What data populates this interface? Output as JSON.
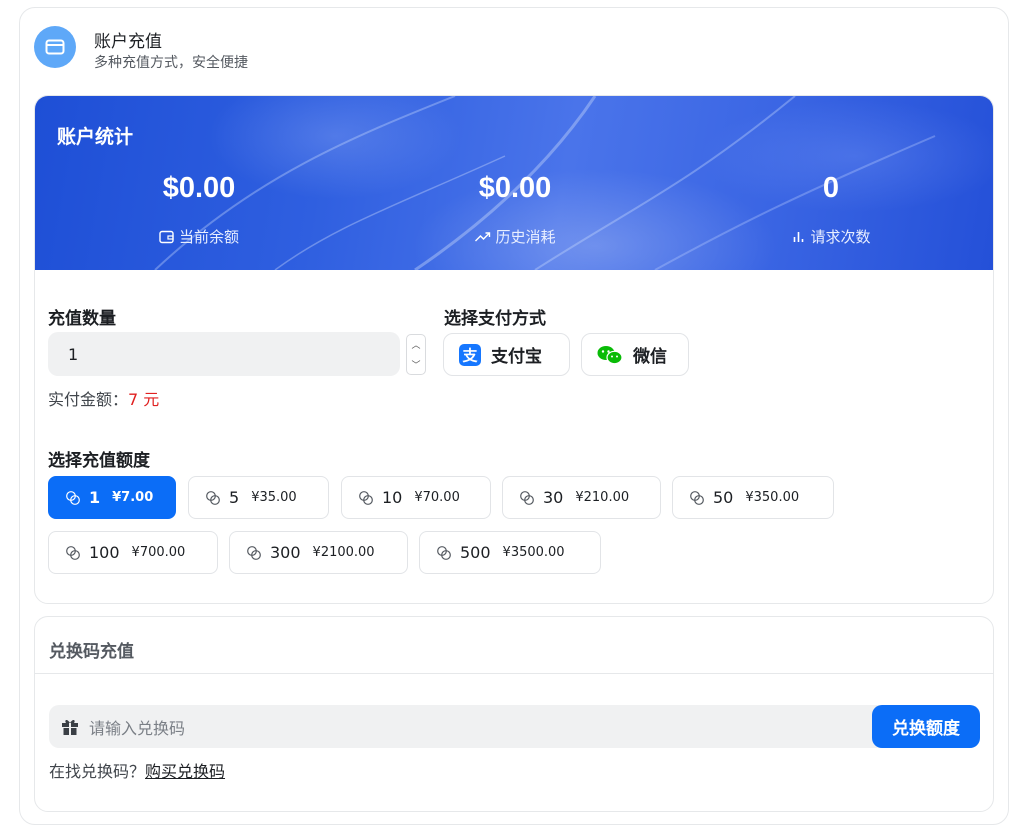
{
  "header": {
    "title": "账户充值",
    "subtitle": "多种充值方式，安全便捷",
    "icon": "credit-card-icon"
  },
  "stats": {
    "title": "账户统计",
    "items": [
      {
        "value": "$0.00",
        "label": "当前余额",
        "icon": "wallet-icon"
      },
      {
        "value": "$0.00",
        "label": "历史消耗",
        "icon": "trend-up-icon"
      },
      {
        "value": "0",
        "label": "请求次数",
        "icon": "bar-chart-icon"
      }
    ]
  },
  "recharge": {
    "quantity_label": "充值数量",
    "quantity_value": "1",
    "paid_prefix": "实付金额：",
    "paid_amount": "7 元",
    "payment_label": "选择支付方式",
    "payment_methods": [
      {
        "label": "支付宝",
        "icon": "alipay-icon",
        "color": "#1677ff"
      },
      {
        "label": "微信",
        "icon": "wechat-icon",
        "color": "#09bb07"
      }
    ],
    "amount_label": "选择充值额度",
    "amounts": [
      {
        "qty": "1",
        "price": "¥7.00",
        "selected": true
      },
      {
        "qty": "5",
        "price": "¥35.00",
        "selected": false
      },
      {
        "qty": "10",
        "price": "¥70.00",
        "selected": false
      },
      {
        "qty": "30",
        "price": "¥210.00",
        "selected": false
      },
      {
        "qty": "50",
        "price": "¥350.00",
        "selected": false
      },
      {
        "qty": "100",
        "price": "¥700.00",
        "selected": false
      },
      {
        "qty": "300",
        "price": "¥2100.00",
        "selected": false
      },
      {
        "qty": "500",
        "price": "¥3500.00",
        "selected": false
      }
    ]
  },
  "redeem": {
    "title": "兑换码充值",
    "placeholder": "请输入兑换码",
    "button": "兑换额度",
    "find_text": "在找兑换码？",
    "buy_link": "购买兑换码",
    "icon": "gift-icon"
  },
  "colors": {
    "accent": "#0b6df7",
    "banner": "#2f5fe0",
    "price_red": "#e02020"
  }
}
